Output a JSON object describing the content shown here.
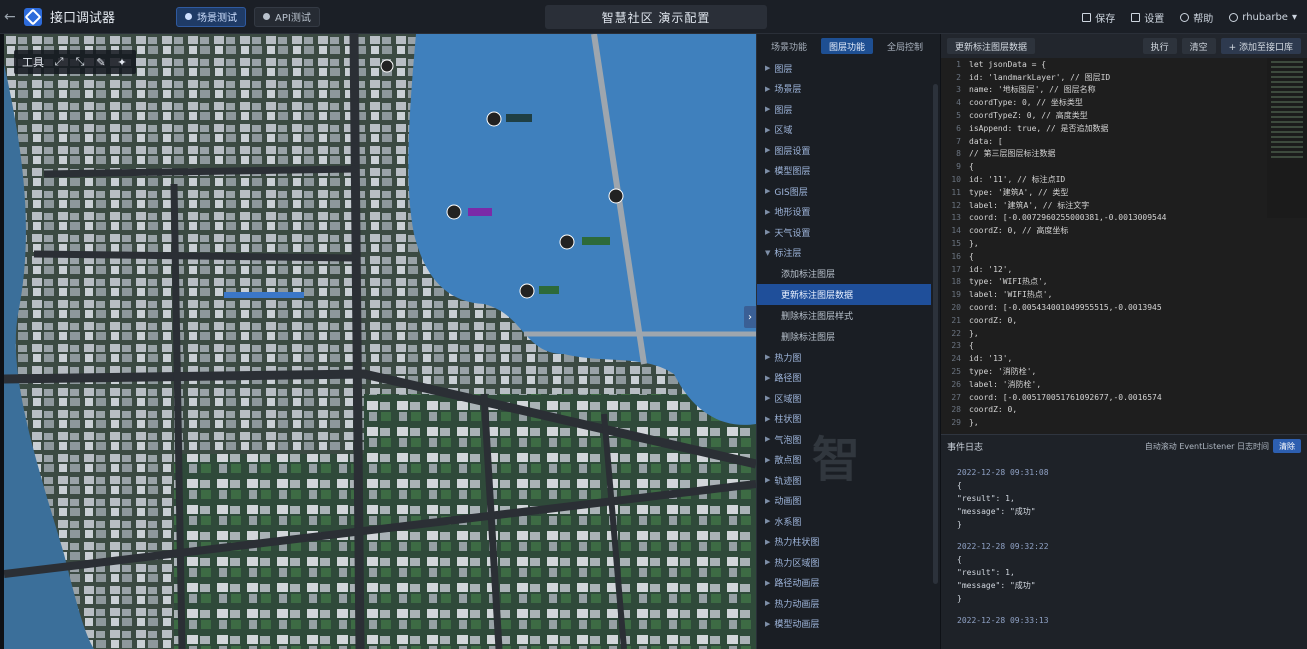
{
  "topbar": {
    "app_title": "接口调试器",
    "modes": [
      "场景测试",
      "API测试"
    ],
    "scene_title": "智慧社区 演示配置",
    "actions": [
      "保存",
      "设置",
      "帮助",
      "rhubarbe"
    ]
  },
  "map": {
    "toolbar_label": "工具"
  },
  "api_panel": {
    "tabs": [
      "场景功能",
      "图层功能",
      "全局控制"
    ],
    "items_before": [
      "图层",
      "场景层",
      "图层",
      "区域",
      "图层设置",
      "模型图层",
      "GIS图层",
      "地形设置",
      "天气设置",
      "标注层"
    ],
    "sub_items": [
      "添加标注图层",
      "更新标注图层数据",
      "删除标注图层样式",
      "删除标注图层"
    ],
    "selected_sub": "更新标注图层数据",
    "items_after": [
      "热力图",
      "路径图",
      "区域图",
      "柱状图",
      "气泡图",
      "散点图",
      "轨迹图",
      "动画图",
      "水系图",
      "热力柱状图",
      "热力区域图",
      "路径动画层",
      "热力动画层",
      "模型动画层"
    ]
  },
  "editor": {
    "title": "更新标注图层数据",
    "buttons": [
      "执行",
      "清空",
      "+ 添加至接口库"
    ],
    "lines": [
      "let jsonData = {",
      "  id: 'landmarkLayer', // 图层ID",
      "  name: '地标图层', // 图层名称",
      "  coordType: 0, // 坐标类型",
      "  coordTypeZ: 0, // 高度类型",
      "  isAppend: true, // 是否追加数据",
      "  data: [",
      "    // 第三层图层标注数据",
      "    {",
      "      id: '11', // 标注点ID",
      "      type: '建筑A', // 类型",
      "      label: '建筑A', // 标注文字",
      "      coord: [-0.0072960255000381,-0.0013009544",
      "      coordZ: 0, // 高度坐标",
      "    },",
      "    {",
      "      id: '12',",
      "      type: 'WIFI热点',",
      "      label: 'WIFI热点',",
      "      coord: [-0.005434001049955515,-0.0013945",
      "      coordZ: 0,",
      "    },",
      "    {",
      "      id: '13',",
      "      type: '消防栓',",
      "      label: '消防栓',",
      "      coord: [-0.005170051761092677,-0.0016574",
      "      coordZ: 0,",
      "    },"
    ]
  },
  "log": {
    "title": "事件日志",
    "options": "自动滚动 EventListener 日志时间",
    "clear_label": "清除",
    "entries": [
      {
        "time": "2022-12-28 09:31:08",
        "result": "\"result\": 1,",
        "message": "\"message\": \"成功\""
      },
      {
        "time": "2022-12-28 09:32:22",
        "result": "\"result\": 1,",
        "message": "\"message\": \"成功\""
      },
      {
        "time": "2022-12-28 09:33:13",
        "result": "",
        "message": ""
      }
    ]
  }
}
